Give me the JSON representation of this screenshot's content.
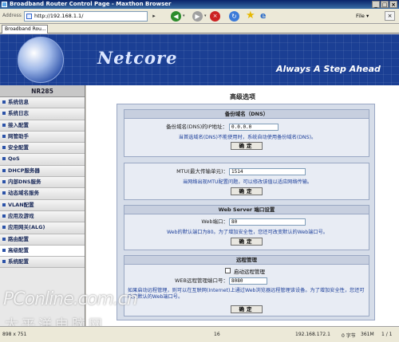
{
  "window": {
    "title": "Broadband Router Control Page - Maxthon Browser",
    "buttons": [
      "_",
      "□",
      "×"
    ]
  },
  "toolbar": {
    "address_label": "Address",
    "url": "http://192.168.1.1/",
    "go": "▸",
    "back": "◀",
    "forward": "▶",
    "stop": "×",
    "refresh": "↻",
    "small_label_1": "▾",
    "small_label_2": "▾",
    "file_menu": "File ▾",
    "close": "×"
  },
  "tabs": [
    {
      "label": "Broadband Rou..."
    }
  ],
  "header": {
    "logo": "Netcore",
    "slogan": "Always A Step Ahead"
  },
  "sidebar": {
    "model": "NR285",
    "items": [
      {
        "label": "系统信息"
      },
      {
        "label": "系统日志"
      },
      {
        "label": "接入配置"
      },
      {
        "label": "网管助手"
      },
      {
        "label": "安全配置"
      },
      {
        "label": "QoS"
      },
      {
        "label": "DHCP服务器"
      },
      {
        "label": "内部DNS服务"
      },
      {
        "label": "动态域名服务"
      },
      {
        "label": "VLAN配置"
      },
      {
        "label": "应用及游戏"
      },
      {
        "label": "应用网关(ALG)"
      },
      {
        "label": "路由配置"
      },
      {
        "label": "高级配置"
      },
      {
        "label": "系统配置"
      }
    ],
    "active_index": 13
  },
  "main": {
    "title": "高级选项",
    "dns": {
      "heading": "备份域名（DNS）",
      "label": "备份域名(DNS)的IP地址：",
      "value": "0.0.0.0",
      "note": "当首选域名(DNS)不能使用时，系统自动使用备份域名(DNS)。",
      "ok": "确定"
    },
    "mtu": {
      "label": "MTU(最大传输单元)：",
      "value": "1514",
      "note": "当网络出现MTU配置问题，可以修改该值以适应网络传输。",
      "ok": "确定"
    },
    "web": {
      "heading": "Web Server 端口设置",
      "label": "Web端口：",
      "value": "80",
      "note": "Web的默认端口为80。为了增加安全性，您还可改变默认的Web端口号。",
      "ok": "确定"
    },
    "remote": {
      "heading": "远程管理",
      "checkbox_label": "启动远程管理",
      "port_label": "WEB远程管理端口号：",
      "port_value": "8080",
      "note": "如果启动远程管理，则可以在互联网(Internet)上通过Web浏览器远程管理该设备。为了增加安全性，您还可改变默认的Web端口号。",
      "ok": "确定"
    }
  },
  "statusbar": {
    "dimensions": "898 x 751",
    "count": "16",
    "ip": "192.168.172.1",
    "bytes": "0 字节",
    "memory": "361M",
    "pages": "1 / 1"
  },
  "watermark": {
    "line1": "PConline.com.cn",
    "line2": "太平洋电脑网"
  },
  "colors": {
    "header_bg": "#1b3f94",
    "panel_bg": "#d6dde9",
    "note_text": "#1c3f9a"
  }
}
